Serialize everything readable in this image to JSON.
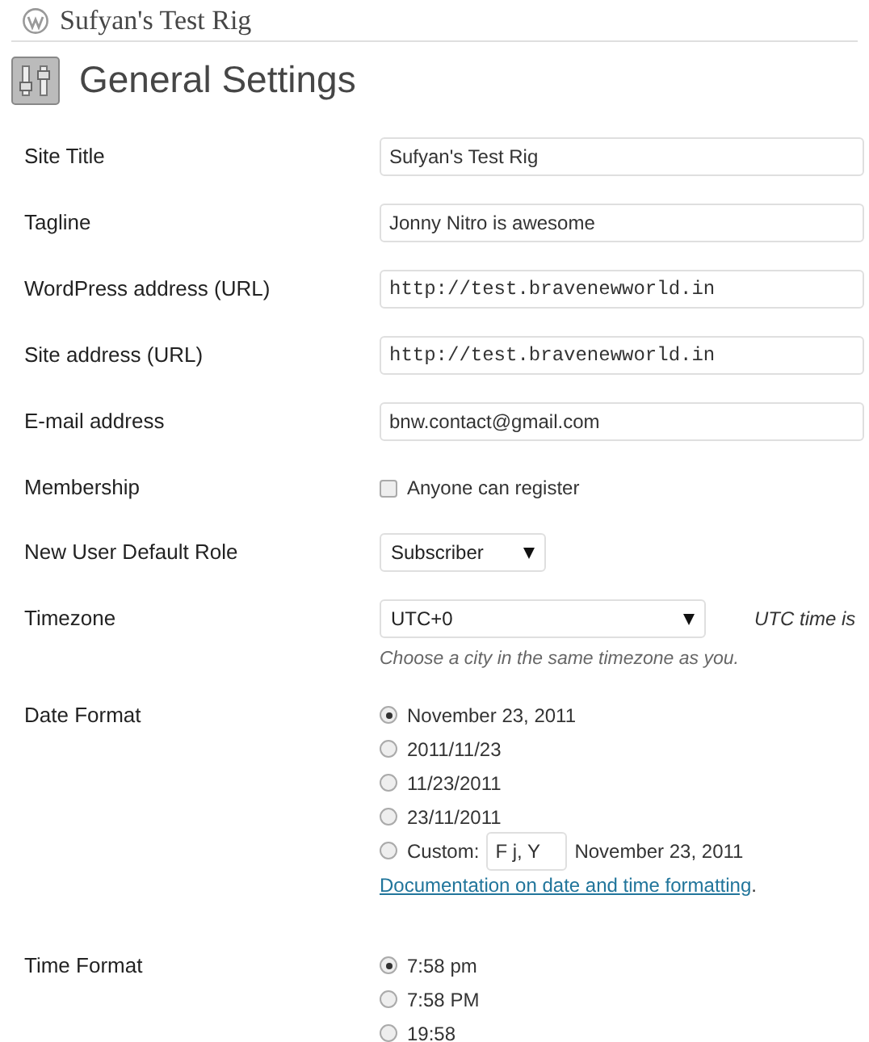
{
  "site_name": "Sufyan's Test Rig",
  "page_title": "General Settings",
  "settings": [
    {
      "kind": "text",
      "label": "Site Title",
      "value": "Sufyan's Test Rig"
    },
    {
      "kind": "text",
      "label": "Tagline",
      "value": "Jonny Nitro is awesome"
    },
    {
      "kind": "url",
      "label": "WordPress address (URL)",
      "value": "http://test.bravenewworld.in"
    },
    {
      "kind": "url",
      "label": "Site address (URL)",
      "value": "http://test.bravenewworld.in"
    },
    {
      "kind": "text",
      "label": "E-mail address",
      "value": "bnw.contact@gmail.com"
    },
    {
      "kind": "checkbox",
      "label": "Membership",
      "option": "Anyone can register",
      "checked": false
    },
    {
      "kind": "select",
      "label": "New User Default Role",
      "value": "Subscriber"
    },
    {
      "kind": "timezone",
      "label": "Timezone",
      "value": "UTC+0",
      "utc_note": "UTC time is",
      "hint": "Choose a city in the same timezone as you."
    },
    {
      "kind": "radios",
      "label": "Date Format",
      "options": [
        {
          "kind": "preset",
          "label": "November 23, 2011",
          "selected": true
        },
        {
          "kind": "preset",
          "label": "2011/11/23",
          "selected": false
        },
        {
          "kind": "preset",
          "label": "11/23/2011",
          "selected": false
        },
        {
          "kind": "preset",
          "label": "23/11/2011",
          "selected": false
        },
        {
          "kind": "custom",
          "label": "Custom:",
          "value": "F j, Y",
          "preview": "November 23, 2011",
          "selected": false
        }
      ],
      "link": "Documentation on date and time formatting",
      "link_after": "."
    },
    {
      "kind": "radios",
      "label": "Time Format",
      "options": [
        {
          "kind": "preset",
          "label": "7:58 pm",
          "selected": true
        },
        {
          "kind": "preset",
          "label": "7:58 PM",
          "selected": false
        },
        {
          "kind": "preset",
          "label": "19:58",
          "selected": false
        }
      ]
    }
  ]
}
